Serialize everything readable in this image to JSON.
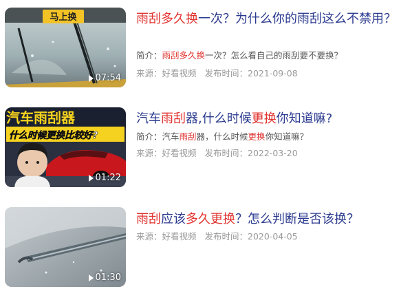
{
  "items": [
    {
      "title_parts": [
        {
          "text": "雨刮多久换",
          "hl": true
        },
        {
          "text": "一次？为什么你的雨刮这么不禁用？",
          "hl": false
        }
      ],
      "desc_parts": [
        {
          "text": "简介：",
          "hl": false
        },
        {
          "text": "雨刮多久换",
          "hl": true
        },
        {
          "text": "一次？怎么看自己的雨刮要不要换？",
          "hl": false
        }
      ],
      "source": "来源：好看视频",
      "date": "发布时间：2021-09-08",
      "duration": "07:54",
      "thumb_badge": "马上换"
    },
    {
      "title_parts": [
        {
          "text": "汽车",
          "hl": false
        },
        {
          "text": "雨刮",
          "hl": true
        },
        {
          "text": "器,什么时候",
          "hl": false
        },
        {
          "text": "更换",
          "hl": true
        },
        {
          "text": "你知道嘛?",
          "hl": false
        }
      ],
      "desc_parts": [
        {
          "text": "简介：汽车",
          "hl": false
        },
        {
          "text": "雨刮",
          "hl": true
        },
        {
          "text": "器，什么时候",
          "hl": false
        },
        {
          "text": "更换",
          "hl": true
        },
        {
          "text": "你知道嘛？",
          "hl": false
        }
      ],
      "source": "来源：好看视频",
      "date": "发布时间：2022-03-20",
      "duration": "01:22",
      "thumb_title": "汽车雨刮器",
      "thumb_subtitle": "什么时候更换比较好?"
    },
    {
      "title_parts": [
        {
          "text": "雨刮",
          "hl": true
        },
        {
          "text": "应该",
          "hl": false
        },
        {
          "text": "多久更换",
          "hl": true
        },
        {
          "text": "？怎么判断是否该换？",
          "hl": false
        }
      ],
      "desc_parts": [],
      "source": "来源：好看视频",
      "date": "发布时间：2020-04-05",
      "duration": "01:30"
    }
  ]
}
